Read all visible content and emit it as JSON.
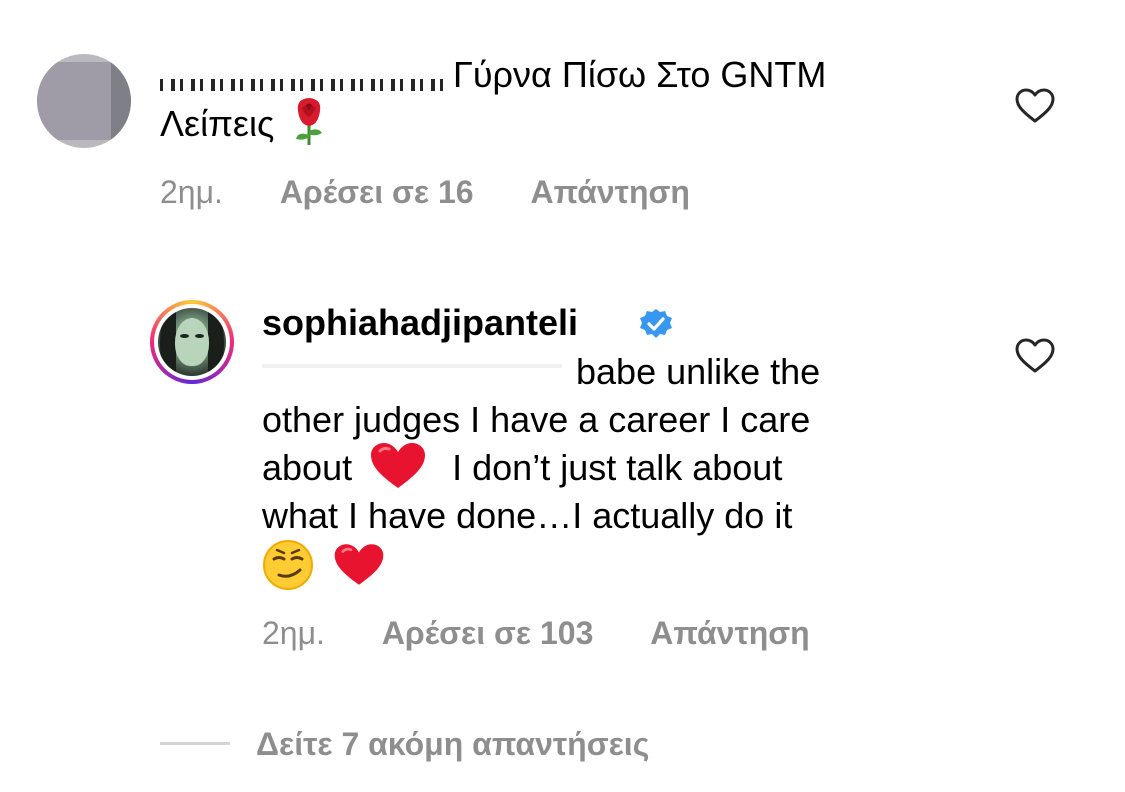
{
  "comment_1": {
    "text_line_1": "Γύρνα Πίσω Στο GNTM",
    "text_line_2": "Λείπεις",
    "emoji": "rose",
    "time": "2ημ.",
    "likes": "Αρέσει σε 16",
    "reply": "Απάντηση"
  },
  "comment_2": {
    "username": "sophiahadjipanteli",
    "verified": true,
    "line_1": "babe unlike the",
    "line_2": "other judges I have a career I care",
    "line_3a": "about",
    "line_3b": "I don’t just talk about",
    "line_4": "what I have done…I actually do it",
    "emojis": [
      "red-heart",
      "smirk",
      "red-heart"
    ],
    "time": "2ημ.",
    "likes": "Αρέσει σε 103",
    "reply": "Απάντηση"
  },
  "view_more": {
    "label": "Δείτε 7 ακόμη απαντήσεις"
  },
  "colors": {
    "text": "#000000",
    "meta": "#8e8e8e",
    "verified": "#3897f0",
    "heart_emoji": "#e8132f",
    "divider": "#d4d4d4"
  }
}
